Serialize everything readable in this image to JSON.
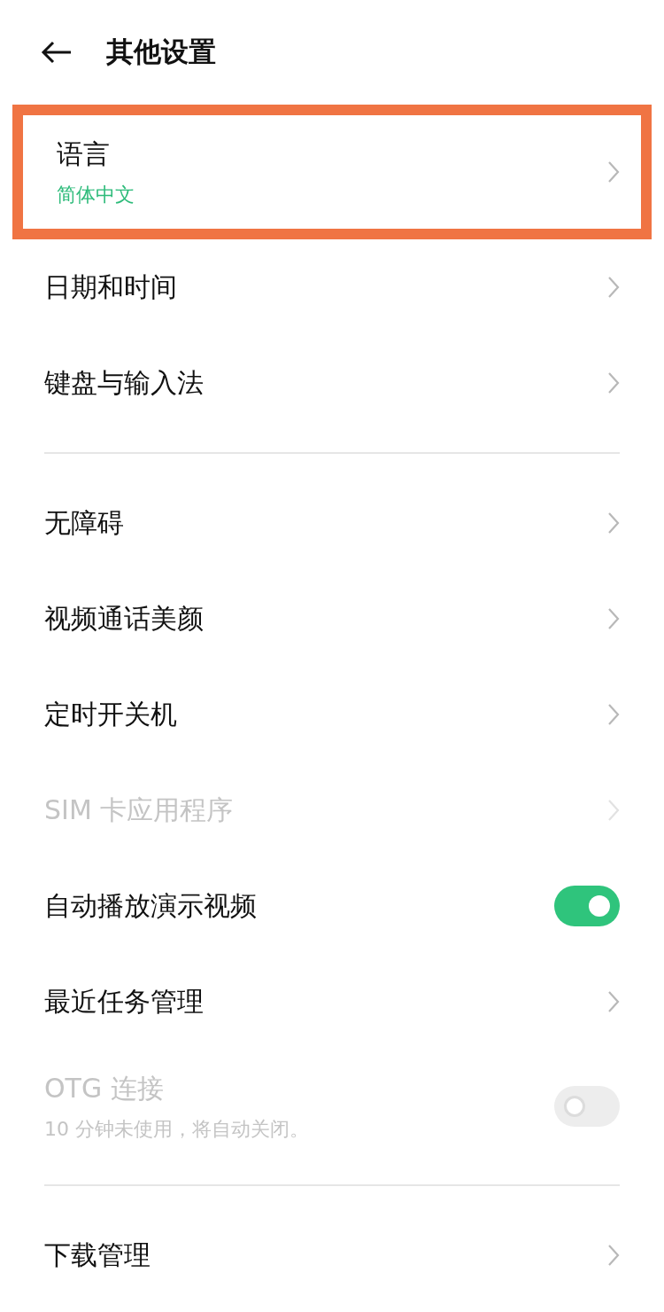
{
  "header": {
    "title": "其他设置"
  },
  "sections": [
    {
      "items": [
        {
          "kind": "link",
          "label": "语言",
          "subtitle": "简体中文",
          "highlighted": true,
          "disabled": false
        },
        {
          "kind": "link",
          "label": "日期和时间",
          "highlighted": false,
          "disabled": false
        },
        {
          "kind": "link",
          "label": "键盘与输入法",
          "highlighted": false,
          "disabled": false
        }
      ]
    },
    {
      "items": [
        {
          "kind": "link",
          "label": "无障碍",
          "highlighted": false,
          "disabled": false
        },
        {
          "kind": "link",
          "label": "视频通话美颜",
          "highlighted": false,
          "disabled": false
        },
        {
          "kind": "link",
          "label": "定时开关机",
          "highlighted": false,
          "disabled": false
        },
        {
          "kind": "link",
          "label": "SIM 卡应用程序",
          "highlighted": false,
          "disabled": true
        },
        {
          "kind": "toggle",
          "label": "自动播放演示视频",
          "on": true,
          "highlighted": false,
          "disabled": false
        },
        {
          "kind": "link",
          "label": "最近任务管理",
          "highlighted": false,
          "disabled": false
        },
        {
          "kind": "toggle",
          "label": "OTG 连接",
          "subtitle": "10 分钟未使用，将自动关闭。",
          "on": false,
          "highlighted": false,
          "disabled": true
        }
      ]
    },
    {
      "items": [
        {
          "kind": "link",
          "label": "下载管理",
          "highlighted": false,
          "disabled": false
        }
      ]
    }
  ]
}
